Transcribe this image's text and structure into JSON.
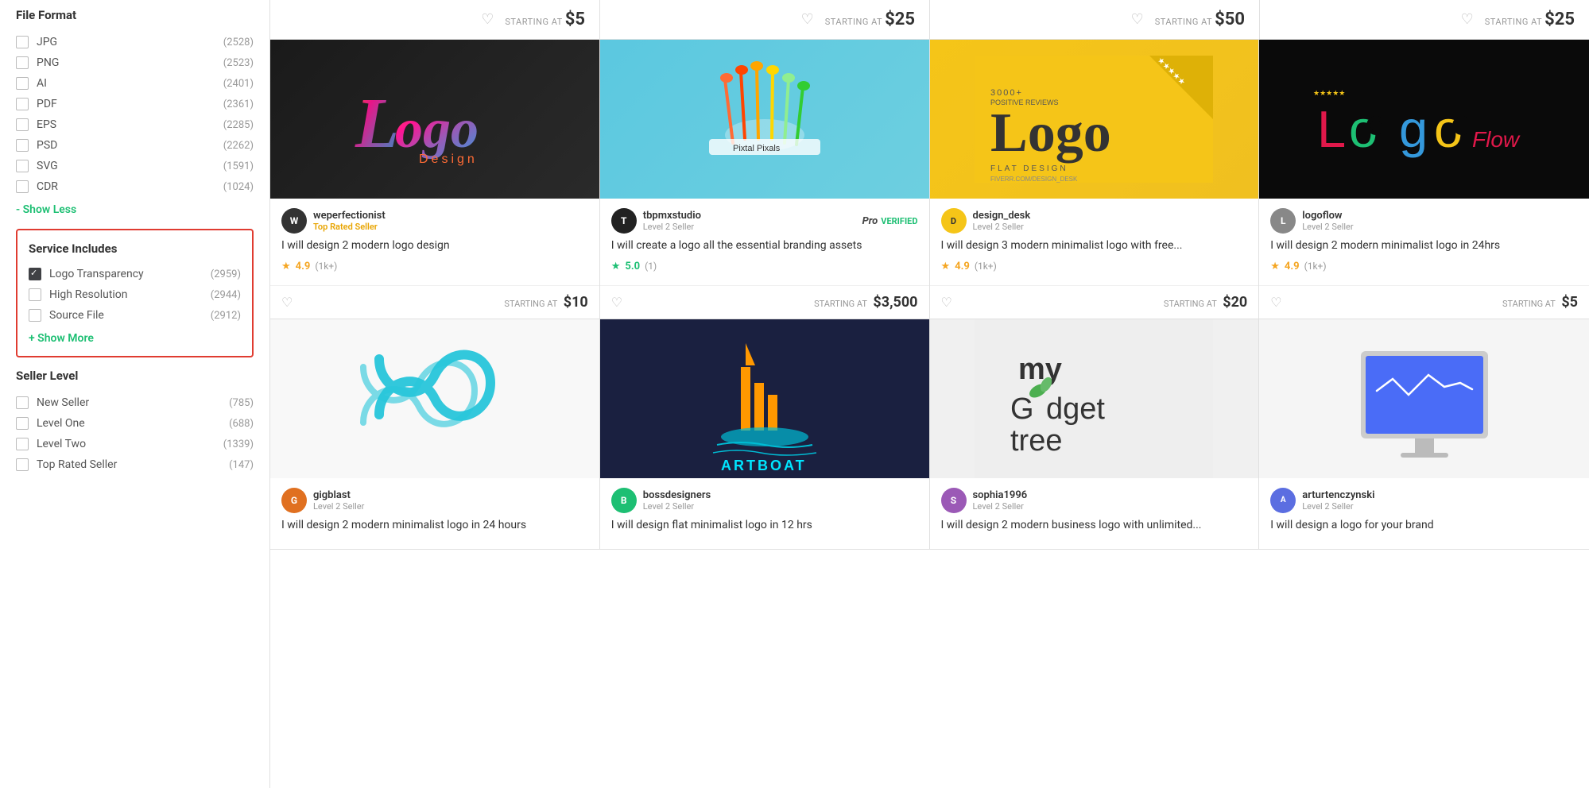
{
  "sidebar": {
    "fileFormat": {
      "title": "File Format",
      "items": [
        {
          "label": "JPG",
          "count": "(2528)",
          "checked": false
        },
        {
          "label": "PNG",
          "count": "(2523)",
          "checked": false
        },
        {
          "label": "AI",
          "count": "(2401)",
          "checked": false
        },
        {
          "label": "PDF",
          "count": "(2361)",
          "checked": false
        },
        {
          "label": "EPS",
          "count": "(2285)",
          "checked": false
        },
        {
          "label": "PSD",
          "count": "(2262)",
          "checked": false
        },
        {
          "label": "SVG",
          "count": "(1591)",
          "checked": false
        },
        {
          "label": "CDR",
          "count": "(1024)",
          "checked": false
        }
      ],
      "showLess": "- Show Less"
    },
    "serviceIncludes": {
      "title": "Service Includes",
      "items": [
        {
          "label": "Logo Transparency",
          "count": "(2959)",
          "checked": true
        },
        {
          "label": "High Resolution",
          "count": "(2944)",
          "checked": false
        },
        {
          "label": "Source File",
          "count": "(2912)",
          "checked": false
        }
      ],
      "showMore": "+ Show More"
    },
    "sellerLevel": {
      "title": "Seller Level",
      "items": [
        {
          "label": "New Seller",
          "count": "(785)",
          "checked": false
        },
        {
          "label": "Level One",
          "count": "(688)",
          "checked": false
        },
        {
          "label": "Level Two",
          "count": "(1339)",
          "checked": false
        },
        {
          "label": "Top Rated Seller",
          "count": "(147)",
          "checked": false
        }
      ]
    }
  },
  "topRow": [
    {
      "startingAt": "STARTING AT",
      "price": "$5"
    },
    {
      "startingAt": "STARTING AT",
      "price": "$25"
    },
    {
      "startingAt": "STARTING AT",
      "price": "$50"
    },
    {
      "startingAt": "STARTING AT",
      "price": "$25"
    }
  ],
  "gigs": [
    {
      "sellerName": "weperfectionist",
      "sellerLevel": "Top Rated Seller",
      "sellerLevelClass": "top-rated",
      "avatarInitial": "W",
      "avatarColor": "av-dark",
      "title": "I will design 2 modern logo design",
      "rating": "4.9",
      "ratingCount": "(1k+)",
      "ratingColor": "yellow",
      "startingAt": "STARTING AT",
      "price": "$10",
      "hasProVerified": false,
      "imgClass": "img-weperfectionist",
      "logoText": "Logo"
    },
    {
      "sellerName": "tbpmxstudio",
      "sellerLevel": "Level 2 Seller",
      "sellerLevelClass": "level2",
      "avatarInitial": "T",
      "avatarColor": "av-dark",
      "title": "I will create a logo all the essential branding assets",
      "rating": "5.0",
      "ratingCount": "(1)",
      "ratingColor": "teal",
      "startingAt": "STARTING AT",
      "price": "$3,500",
      "hasProVerified": true,
      "imgClass": "img-tbpmx",
      "logoText": "spoons"
    },
    {
      "sellerName": "design_desk",
      "sellerLevel": "Level 2 Seller",
      "sellerLevelClass": "level2",
      "avatarInitial": "D",
      "avatarColor": "av-yellow",
      "title": "I will design 3 modern minimalist logo with free...",
      "rating": "4.9",
      "ratingCount": "(1k+)",
      "ratingColor": "yellow",
      "startingAt": "STARTING AT",
      "price": "$20",
      "hasProVerified": false,
      "imgClass": "img-design-desk",
      "logoText": "Logo"
    },
    {
      "sellerName": "logoflow",
      "sellerLevel": "Level 2 Seller",
      "sellerLevelClass": "level2",
      "avatarInitial": "L",
      "avatarColor": "av-gray",
      "title": "I will design 2 modern minimalist logo in 24hrs",
      "rating": "4.9",
      "ratingCount": "(1k+)",
      "ratingColor": "yellow",
      "startingAt": "STARTING AT",
      "price": "$5",
      "hasProVerified": false,
      "imgClass": "img-logoflow",
      "logoText": "Logo Flow"
    },
    {
      "sellerName": "gigblast",
      "sellerLevel": "Level 2 Seller",
      "sellerLevelClass": "level2",
      "avatarInitial": "G",
      "avatarColor": "av-orange",
      "title": "I will design 2 modern minimalist logo in 24 hours",
      "rating": "",
      "ratingCount": "",
      "ratingColor": "yellow",
      "startingAt": "",
      "price": "",
      "hasProVerified": false,
      "imgClass": "img-gigblast",
      "logoText": "logo loop"
    },
    {
      "sellerName": "bossdesigners",
      "sellerLevel": "Level 2 Seller",
      "sellerLevelClass": "level2",
      "avatarInitial": "B",
      "avatarColor": "av-teal",
      "title": "I will design flat minimalist logo in 12 hrs",
      "rating": "",
      "ratingCount": "",
      "ratingColor": "yellow",
      "startingAt": "",
      "price": "",
      "hasProVerified": false,
      "imgClass": "img-bossdesigners",
      "logoText": "ARTBOAT"
    },
    {
      "sellerName": "sophia1996",
      "sellerLevel": "Level 2 Seller",
      "sellerLevelClass": "level2",
      "avatarInitial": "S",
      "avatarColor": "av-purple",
      "title": "I will design 2 modern business logo with unlimited...",
      "rating": "",
      "ratingCount": "",
      "ratingColor": "yellow",
      "startingAt": "",
      "price": "",
      "hasProVerified": false,
      "imgClass": "img-sophia",
      "logoText": "my godget tree"
    },
    {
      "sellerName": "arturtenczynski",
      "sellerLevel": "Level 2 Seller",
      "sellerLevelClass": "level2",
      "avatarInitial": "A",
      "avatarColor": "av-blue",
      "title": "I will design a logo for your brand",
      "rating": "",
      "ratingCount": "",
      "ratingColor": "yellow",
      "startingAt": "",
      "price": "",
      "hasProVerified": false,
      "imgClass": "img-artur",
      "logoText": "monitor"
    }
  ]
}
